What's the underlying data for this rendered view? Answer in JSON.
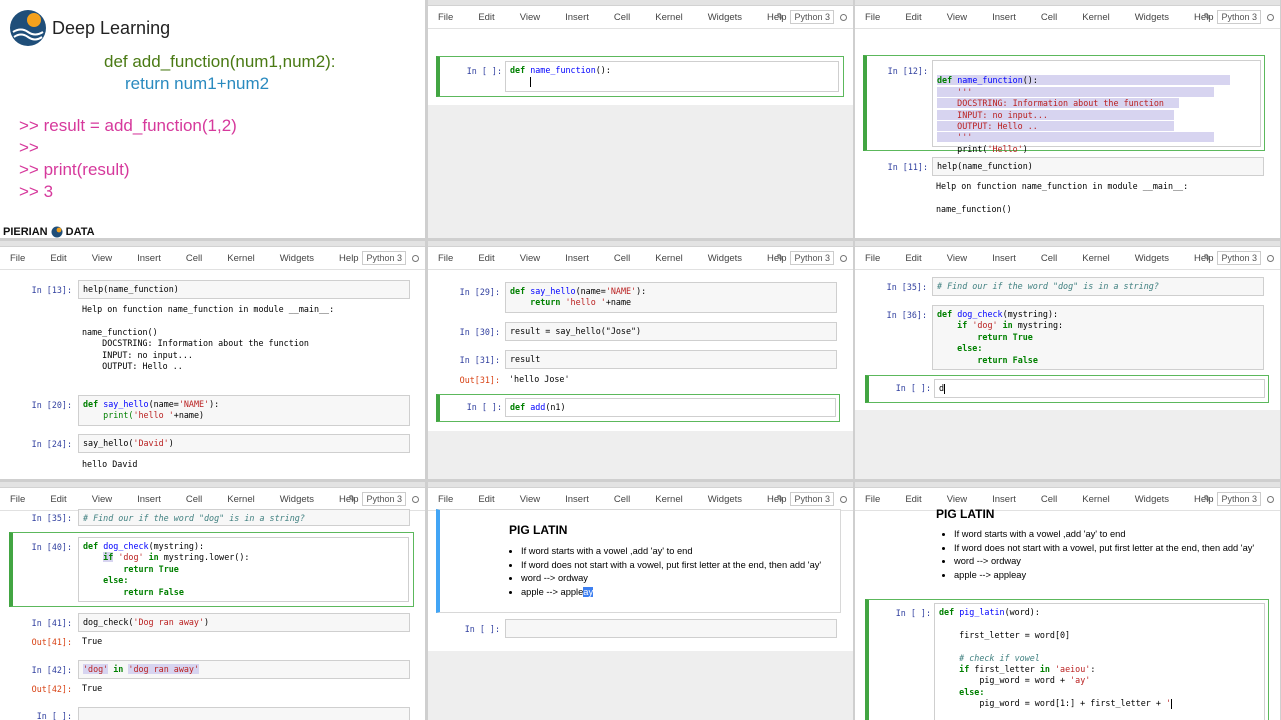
{
  "menu": {
    "file": "File",
    "edit": "Edit",
    "view": "View",
    "insert": "Insert",
    "cell": "Cell",
    "kernel": "Kernel",
    "widgets": "Widgets",
    "help": "Help",
    "kernel_name": "Python 3"
  },
  "slide": {
    "logo_text": "Deep Learning",
    "code_line1": "def add_function(num1,num2):",
    "code_line2": "return num1+num2",
    "repl1": ">> result = add_function(1,2)",
    "repl2": ">>",
    "repl3": ">> print(result)",
    "repl4": ">> 3",
    "brand_left": "PIERIAN",
    "brand_right": "DATA"
  },
  "p2": {
    "prompt": "In [ ]:",
    "code_kw": "def",
    "code_fn": "name_function",
    "code_rest": "():"
  },
  "p3": {
    "prompt12": "In [12]:",
    "def": "def",
    "fn": "name_function",
    "paren": "():",
    "q1": "'''",
    "doc1": "DOCSTRING: Information about the function",
    "doc2": "INPUT: no input...",
    "doc3": "OUTPUT: Hello ..",
    "q2": "'''",
    "print_fn": "print(",
    "print_str": "'Hello'",
    "print_end": ")",
    "prompt11": "In [11]:",
    "help_call": "help(name_function)",
    "out1": "Help on function name_function in module __main__:",
    "out2": "name_function()"
  },
  "p4": {
    "prompt13": "In [13]:",
    "help_call": "help(name_function)",
    "out": "Help on function name_function in module __main__:\n\nname_function()\n    DOCSTRING: Information about the function\n    INPUT: no input...\n    OUTPUT: Hello ..",
    "prompt20": "In [20]:",
    "say_def": "def",
    "say_fn": "say_hello",
    "say_args": "(name=",
    "say_default": "'NAME'",
    "say_close": "):",
    "say_print": "print(",
    "say_str": "'hello '",
    "say_plus": "+name)",
    "prompt24": "In [24]:",
    "call": "say_hello(",
    "call_str": "'David'",
    "call_end": ")",
    "result": "hello David"
  },
  "p5": {
    "prompt29": "In [29]:",
    "def": "def",
    "fn": "say_hello",
    "args": "(name=",
    "default": "'NAME'",
    "close": "):",
    "ret": "return",
    "ret_str": "'hello '",
    "ret_rest": "+name",
    "prompt30": "In [30]:",
    "assign": "result = say_hello(\"Jose\")",
    "prompt31": "In [31]:",
    "result_name": "result",
    "out31": "Out[31]:",
    "out_val": "'hello Jose'",
    "prompt_new": "In [ ]:",
    "new_def": "def",
    "new_fn": "add",
    "new_rest": "(n1)"
  },
  "p6": {
    "prompt35": "In [35]:",
    "comment": "# Find our if the word \"dog\" is in a string?",
    "prompt36": "In [36]:",
    "def": "def",
    "fn": "dog_check",
    "args": "(mystring):",
    "if": "if",
    "str_dog": "'dog'",
    "in": "in",
    "mystring": "mystring:",
    "ret": "return",
    "true": "True",
    "else": "else:",
    "false": "False",
    "prompt_new": "In [ ]:",
    "typed": "d"
  },
  "p7": {
    "prompt35": "In [35]:",
    "comment": "# Find our if the word \"dog\" is in a string?",
    "prompt40": "In [40]:",
    "def": "def",
    "fn": "dog_check",
    "args": "(mystring):",
    "if": "if",
    "str_dog": "'dog'",
    "in": "in",
    "lower": "mystring.lower():",
    "ret": "return",
    "true": "True",
    "else": "else:",
    "false": "False",
    "prompt41": "In [41]:",
    "call41": "dog_check(",
    "call41_str": "'Dog ran away'",
    "call41_end": ")",
    "out41": "Out[41]:",
    "out41_val": "True",
    "prompt42": "In [42]:",
    "c42_a": "'dog'",
    "c42_in": "in",
    "c42_b": "'dog ran away'",
    "out42": "Out[42]:",
    "out42_val": "True",
    "prompt_new": "In [ ]:"
  },
  "p8": {
    "title": "PIG LATIN",
    "b1": "If word starts with a vowel ,add 'ay' to end",
    "b2": "If word does not start with a vowel, put first letter at the end, then add 'ay'",
    "b3": "word --> ordway",
    "b4a": "apple --> apple",
    "b4b": "ay",
    "prompt_new": "In [ ]:"
  },
  "p9": {
    "title": "PIG LATIN",
    "b1": "If word starts with a vowel ,add 'ay' to end",
    "b2": "If word does not start with a vowel, put first letter at the end, then add 'ay'",
    "b3": "word --> ordway",
    "b4": "apple --> appleay",
    "prompt": "In [ ]:",
    "def": "def",
    "fn": "pig_latin",
    "args": "(word):",
    "line_first": "first_letter = word[0]",
    "comment": "# check if vowel",
    "if": "if",
    "if_rest": "first_letter",
    "in": "in",
    "vowels": "'aeiou'",
    "colon": ":",
    "pw1": "pig_word = word + ",
    "ay": "'ay'",
    "else": "else:",
    "pw2": "pig_word = word[1:] + first_letter + ",
    "tick": "'"
  }
}
